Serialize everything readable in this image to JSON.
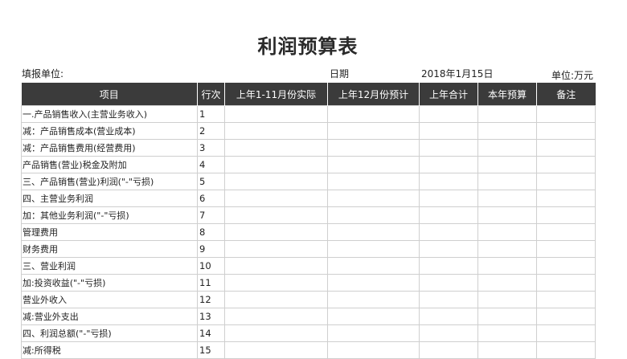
{
  "title": "利润预算表",
  "meta": {
    "unit_label": "填报单位:",
    "date_label": "日期",
    "date_value": "2018年1月15日",
    "money_unit": "单位:万元"
  },
  "columns": [
    "项目",
    "行次",
    "上年1-11月份实际",
    "上年12月份预计",
    "上年合计",
    "本年预算",
    "备注"
  ],
  "rows": [
    {
      "item": "一.产品销售收入(主营业务收入)",
      "line": "1"
    },
    {
      "item": "减：产品销售成本(营业成本)",
      "line": "2"
    },
    {
      "item": "减：产品销售费用(经营费用)",
      "line": "3"
    },
    {
      "item": "产品销售(营业)税金及附加",
      "line": "4"
    },
    {
      "item": "三、产品销售(营业)利润(\"-\"亏损)",
      "line": "5"
    },
    {
      "item": "四、主营业务利润",
      "line": "6"
    },
    {
      "item": "加：其他业务利润(\"-\"亏损)",
      "line": "7"
    },
    {
      "item": "管理费用",
      "line": "8"
    },
    {
      "item": "财务费用",
      "line": "9"
    },
    {
      "item": "三、营业利润",
      "line": "10"
    },
    {
      "item": "加:投资收益(\"-\"亏损)",
      "line": "11"
    },
    {
      "item": "营业外收入",
      "line": "12"
    },
    {
      "item": "减:营业外支出",
      "line": "13"
    },
    {
      "item": "四、利润总额(\"-\"亏损)",
      "line": "14"
    },
    {
      "item": "减:所得税",
      "line": "15"
    }
  ],
  "colors": {
    "header_bg": "#3b3b3b",
    "header_text": "#ffffff",
    "grid": "#cfcfcf"
  }
}
